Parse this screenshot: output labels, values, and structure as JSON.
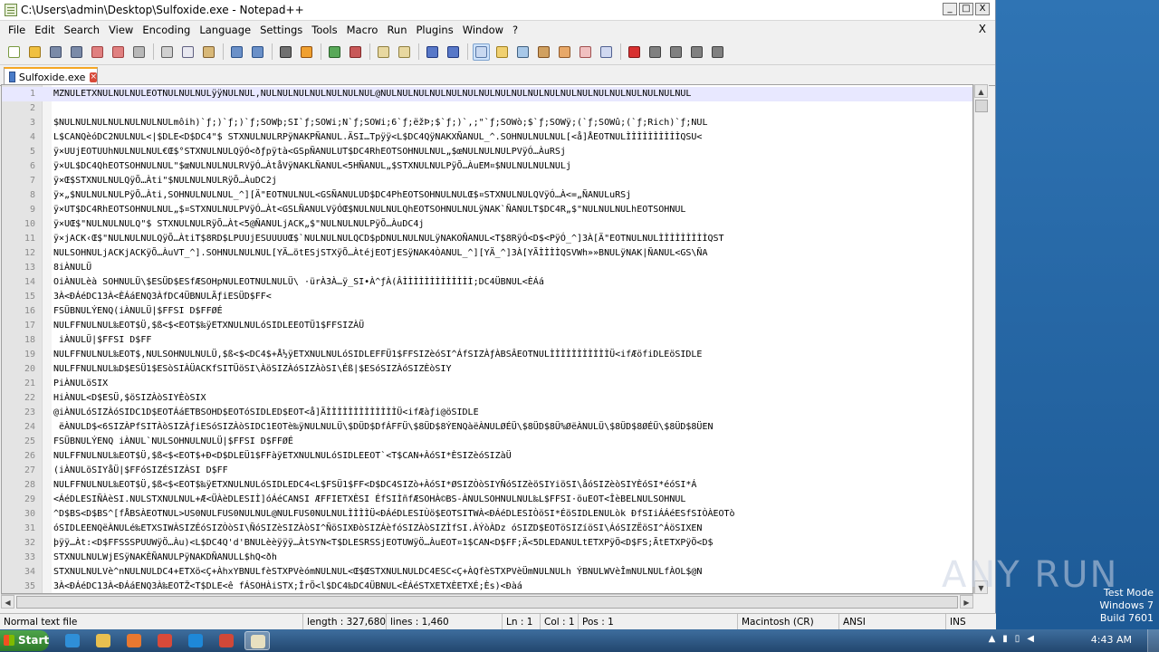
{
  "window": {
    "title": "C:\\Users\\admin\\Desktop\\Sulfoxide.exe - Notepad++",
    "minimize": "_",
    "maximize": "□",
    "close": "X"
  },
  "menu": {
    "items": [
      "File",
      "Edit",
      "Search",
      "View",
      "Encoding",
      "Language",
      "Settings",
      "Tools",
      "Macro",
      "Run",
      "Plugins",
      "Window",
      "?"
    ],
    "close_doc": "X"
  },
  "toolbar": {
    "icons": [
      {
        "name": "new-file-icon",
        "color": "#ffffff",
        "border": "#7a9a40"
      },
      {
        "name": "open-file-icon",
        "color": "#f0c040",
        "border": "#a07818"
      },
      {
        "name": "save-icon",
        "color": "#7a8aa8",
        "border": "#404c68"
      },
      {
        "name": "save-all-icon",
        "color": "#7a8aa8",
        "border": "#404c68"
      },
      {
        "name": "close-icon",
        "color": "#e08080",
        "border": "#a04040"
      },
      {
        "name": "close-all-icon",
        "color": "#e08080",
        "border": "#a04040"
      },
      {
        "name": "print-icon",
        "color": "#b8b8b8",
        "border": "#606060"
      },
      {
        "sep": true
      },
      {
        "name": "cut-icon",
        "color": "#d0d0d0",
        "border": "#606060"
      },
      {
        "name": "copy-icon",
        "color": "#e8e8f0",
        "border": "#606080"
      },
      {
        "name": "paste-icon",
        "color": "#d8b878",
        "border": "#806030"
      },
      {
        "sep": true
      },
      {
        "name": "undo-icon",
        "color": "#6a90c8",
        "border": "#2a5088"
      },
      {
        "name": "redo-icon",
        "color": "#6a90c8",
        "border": "#2a5088"
      },
      {
        "sep": true
      },
      {
        "name": "find-icon",
        "color": "#707070",
        "border": "#303030"
      },
      {
        "name": "replace-icon",
        "color": "#f0a030",
        "border": "#905010"
      },
      {
        "sep": true
      },
      {
        "name": "zoom-in-icon",
        "color": "#58a858",
        "border": "#286028"
      },
      {
        "name": "zoom-out-icon",
        "color": "#c85858",
        "border": "#802828"
      },
      {
        "sep": true
      },
      {
        "name": "sync-vertical-icon",
        "color": "#e8d8a0",
        "border": "#908040"
      },
      {
        "name": "sync-horizontal-icon",
        "color": "#e8d8a0",
        "border": "#908040"
      },
      {
        "sep": true
      },
      {
        "name": "word-wrap-icon",
        "color": "#5878c8",
        "border": "#203880"
      },
      {
        "name": "show-all-chars-icon",
        "color": "#5878c8",
        "border": "#203880"
      },
      {
        "sep": true
      },
      {
        "name": "indent-guide-icon",
        "color": "#c8d8f0",
        "border": "#5878a8",
        "active": true
      },
      {
        "name": "udl-icon",
        "color": "#f0d070",
        "border": "#a08020"
      },
      {
        "name": "doc-map-icon",
        "color": "#a8c8e8",
        "border": "#406080"
      },
      {
        "name": "function-list-icon",
        "color": "#d0a060",
        "border": "#805020"
      },
      {
        "name": "folder-workspace-icon",
        "color": "#e8a868",
        "border": "#905828"
      },
      {
        "name": "monitoring-icon",
        "color": "#f0c0c0",
        "border": "#a05050"
      },
      {
        "name": "eye-icon",
        "color": "#d0d8f0",
        "border": "#506090"
      },
      {
        "sep": true
      },
      {
        "name": "record-macro-icon",
        "color": "#d83030",
        "border": "#801818"
      },
      {
        "name": "stop-macro-icon",
        "color": "#808080",
        "border": "#404040"
      },
      {
        "name": "play-macro-icon",
        "color": "#808080",
        "border": "#404040"
      },
      {
        "name": "play-multiple-icon",
        "color": "#808080",
        "border": "#404040"
      },
      {
        "name": "save-macro-icon",
        "color": "#808080",
        "border": "#404040"
      }
    ]
  },
  "tab": {
    "label": "Sulfoxide.exe",
    "close": "×"
  },
  "editor": {
    "lines": [
      {
        "n": "1",
        "t": "MZNULETXNULNULNULEOTNULNULNULÿÿNULNUL,NULNULNULNULNULNULNUL@NULNULNULNULNULNULNULNULNULNULNULNULNULNULNULNULNULNULNUL"
      },
      {
        "n": "2",
        "t": ""
      },
      {
        "n": "3",
        "t": "$NULNULNULNULNULNULNULmôih)`ƒ;)`ƒ;)`ƒ;SOWþ;SI`ƒ;SOWi;N`ƒ;SOWi;6`ƒ;ëžÞ;$`ƒ;)`,;\"`ƒ;SOWò;$`ƒ;SOWÿ;(`ƒ;SOWû;(`ƒ;Rich)`ƒ;NUL"
      },
      {
        "n": "4",
        "t": "L$CANQèóDC2NULNUL<|$DLE<D$DC4\"$ STXNULNULRPÿNAKPÑANUL.ÄSI…Tpÿÿ<L$DC4QÿNAKXÑANUL_^.SOHNULNULNUL[<å]ÅEOTNULÌÌÌÌÌÌÌÌÌÌQSU<"
      },
      {
        "n": "5",
        "t": "ÿ×UUjEOTUUhNULNULNUL€Œ$°STXNULNULQÿÓ<ðƒpÿtà<GSpÑANULUT$DC4RhEOTSOHNULNUL„$œNULNULNULPVÿÓ…ÀuRSj"
      },
      {
        "n": "6",
        "t": "ÿ×UL$DC4QhEOTSOHNULNUL\"$œNULNULNULRVÿÓ…ÀtåVÿNAKLÑANUL<5HÑANUL„$STXNULNULPÿÕ…ÀuEM¤$NULNULNULNULj"
      },
      {
        "n": "7",
        "t": "ÿ×Œ$STXNULNULQÿÕ…Àti\"$NULNULNULRÿÕ…ÀuDC2j"
      },
      {
        "n": "8",
        "t": "ÿ×„$NULNULNULPÿÕ…Àti,SOHNULNULNUL_^][Ä\"EOTNULNUL<GSÑANULUD$DC4PhEOTSOHNULNULŒ$¤STXNULNULQVÿÓ…À<=„ÑANULuRSj"
      },
      {
        "n": "9",
        "t": "ÿ×UT$DC4RhEOTSOHNULNUL„$¤STXNULNULPVÿÓ…Àt<GSLÑANULVÿÓŒ$NULNULNULQhEOTSOHNULNULÿNAK`ÑANULT$DC4R„$\"NULNULNULhEOTSOHNUL"
      },
      {
        "n": "10",
        "t": "ÿ×UŒ$\"NULNULNULQ\"$ STXNULNULRÿÕ…Àt<5@ÑANULjACK„$\"NULNULNULPÿÕ…ÀuDC4j"
      },
      {
        "n": "11",
        "t": "ÿ×jACK‹Œ$\"NULNULNULQÿÕ…ÀtiT$8RD$LPUUjESUUUUŒ$`NULNULNULQCD$pDNULNULNULÿNAKOÑANUL<T$8RÿÓ<D$<PÿÓ_^]3À[Ä\"EOTNULNULÌÌÌÌÌÌÌÌÌQST"
      },
      {
        "n": "12",
        "t": "NULSOHNULjACKjACKÿÕ…ÀuVT_^].SOHNULNULNUL[YÄ…ötESjSTXÿÕ…ÀtéjEOTjESÿNAK4ÒANUL_^][YÄ_^]3À[YÃÌÌÌÌQSVWh»»BNULÿNAK|ÑANUL<GS\\ÑA"
      },
      {
        "n": "13",
        "t": "8iÀNULÜ"
      },
      {
        "n": "14",
        "t": "OiÀNULèà SOHNULÜ\\$ESÜD$ESfÆSOHpNULEOTNULNULÜ\\ ·ürÀ3À…ÿ_SI•À^ƒÀ(ÂÌÌÌÌÌÌÌÌÌÌÌÌÌ;DC4ÜBNUL<ÈÁá"
      },
      {
        "n": "15",
        "t": "3À<ÐÁéDC13À<ÈÁáENQ3ÀfDC4ÜBNULÃƒiESÜD$FF<"
      },
      {
        "n": "16",
        "t": "FSÜBNULÝENQ(iÀNULÜ|$FFSI D$FFØÉ"
      },
      {
        "n": "17",
        "t": "NULFFNULNUL‰EOT$Ü,$ß<$<EOT$‰ÿETXNULNULóSIDLEEOTÜ1$FFSIZÀÜ"
      },
      {
        "n": "18",
        "t": " iÀNULÜ|$FFSI D$FF"
      },
      {
        "n": "19",
        "t": "NULFFNULNUL‰EOT$,NULSOHNULNULÜ,$ß<$<DC4$+Å½ÿETXNULNULóSIDLEFFÜ1$FFSIZèóSI^ÁfSIZÀƒÀBSÂEOTNULÌÌÌÌÌÌÌÌÌÌÌÜ<ifÆöfiDLEöSIDLE"
      },
      {
        "n": "20",
        "t": "NULFFNULNUL‰D$ESÜ1$ESòSIÀÜACKfSITÜöSI\\ÀöSIZÀóSIZÀòSI\\Éß|$ESóSIZÀóSIZÈòSIY"
      },
      {
        "n": "21",
        "t": "PiÀNULöSIX"
      },
      {
        "n": "22",
        "t": "HiÀNUL<D$ESÜ,$öSIZÀòSIYÈòSIX"
      },
      {
        "n": "23",
        "t": "@iÀNULóSIZÀóSIDC1D$EOTÁáETBSOHD$EOTóSIDLED$EOT<å]ÃÌÌÌÌÌÌÌÌÌÌÌÌÌÜ<ifÆàƒi@öSIDLE"
      },
      {
        "n": "24",
        "t": " ëÀNULD$<6SIZÀPfSITÀòSIZÀƒiESóSIZÀòSIDC1EOTè‰ÿNULNULÜ\\$DÜD$DfÁFFÜ\\$8ÜD$8ÝENQàëÀNULØÉÜ\\$8ÜD$8Ü%ØëÀNULÜ\\$8ÜD$8ØÉÜ\\$8ÜD$8ÜEN"
      },
      {
        "n": "25",
        "t": "FSÜBNULÝENQ iÀNUL`NULSOHNULNULÜ|$FFSI D$FFØÉ"
      },
      {
        "n": "26",
        "t": "NULFFNULNUL‰EOT$Ü,$ß<$<EOT$+Ð<D$DLEÜ1$FFàÿETXNULNULóSIDLEEOT`<T$CAN+ÀóSI*ÈSIZèóSIZàÜ"
      },
      {
        "n": "27",
        "t": "(iÀNULöSIYåÜ|$FFóSIZÉSIZÀSI D$FF"
      },
      {
        "n": "28",
        "t": "NULFFNULNUL‰EOT$Ü,$ß<$<EOT$‰ÿETXNULNULóSIDLEDC4<L$FSÜ1$FF<D$DC4SIZò+ÀóSI*ØSIZÒòSIYÑóSIZèöSIYiöSI\\åóSIZèòSIYÈóSI*éóSI*Á"
      },
      {
        "n": "29",
        "t": "<ÁéDLESIÑÀèSI.NULSTXNULNUL+Æ<ÜÀèDLESIÌ]óÁéCANSI ÆFFIETXÈSI ÉfSIÌñfÆSOHÀ©BS-ÀNULSOHNULNUL‰L$FFSI·öuEOT<ÎèBELNULSOHNUL"
      },
      {
        "n": "30",
        "t": "^D$BS<D$BS^[fÅBSÀEOTNUL>US0NULFUS0NULNUL@NULFUS0NULNULÌÌÌÌÜ<ÐÁéDLESIÙö$EOTSITWÀ<ÐÁéDLESIÒöSI*ÉöSIDLENULòk ÐfSIiÁÁéESfSIÒÀEOTò"
      },
      {
        "n": "31",
        "t": "óSIDLEENQëÀNULé‰ETXSIWÀSIZÉóSIZÒòSI\\ÑóSIZèSIZÀòSI^ÑöSIXÐòSIZÁèfóSIZÀòSIZÌfSI.ÀÝòÀDz óSIZD$EOTöSIZíöSI\\ÁóSIZËöSI^ÁöSIXEN"
      },
      {
        "n": "32",
        "t": "þÿÿ…Àt:<D$FFSSSPUUWÿÖ…Àu)<L$DC4Q'd'BNULèèÿÿÿ…ÀtSYN<T$DLESRSSjEOTUWÿÖ…ÀuEOT¤1$CAN<D$FF;Ä<5DLEDANULtETXPÿÖ<D$FS;ÃtETXPÿÖ<D$"
      },
      {
        "n": "33",
        "t": "STXNULNULWjESÿNAKÈÑANULPÿNAKDÑANULL$hQ<ðh"
      },
      {
        "n": "34",
        "t": "STXNULNULVè^nNULNULDC4+ETXö<Ç+ÀhxYBNULfèSTXPVèómNULNUL<Œ$ŒSTXNULNULDC4ESC<Ç+ÀQfèSTXPVèÜmNULNULh ÝBNULWVèÎmNULNULfÀOL$@N"
      },
      {
        "n": "35",
        "t": "3À<ÐÁéDC13À<ÐÁáENQ3À‰EOTŽ<T$DLE<ê fÁSOHÀiSTX;ÎrÖ<l$DC4‰DC4ÜBNUL<ÈÁéSTXETXÈETXÉ;Ès)<Ðàá"
      }
    ]
  },
  "status": {
    "type": "Normal text file",
    "length": "length : 327,680",
    "lines": "lines : 1,460",
    "ln": "Ln : 1",
    "col": "Col : 1",
    "pos": "Pos : 1",
    "eol": "Macintosh (CR)",
    "encoding": "ANSI",
    "mode": "INS"
  },
  "desktop": {
    "watermark": "ANY RUN",
    "test_mode": "Test Mode",
    "os": "Windows 7",
    "build": "Build 7601"
  },
  "taskbar": {
    "start": "Start",
    "clock": "4:43 AM",
    "apps": [
      {
        "name": "ie-taskbar-icon",
        "color": "#2f8fd8"
      },
      {
        "name": "explorer-taskbar-icon",
        "color": "#e8c050"
      },
      {
        "name": "media-player-taskbar-icon",
        "color": "#e87830"
      },
      {
        "name": "chrome-taskbar-icon",
        "color": "#d84a3a"
      },
      {
        "name": "edge-taskbar-icon",
        "color": "#1e88d8"
      },
      {
        "name": "app-grid-taskbar-icon",
        "color": "#d04838"
      },
      {
        "name": "notepadpp-taskbar-icon",
        "color": "#e8e0c0",
        "active": true
      }
    ]
  }
}
